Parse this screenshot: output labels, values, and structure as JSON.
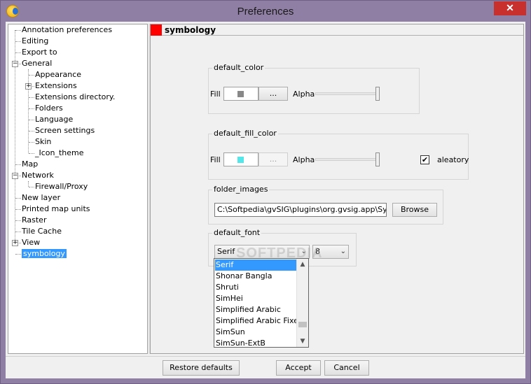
{
  "window": {
    "title": "Preferences",
    "close_label": "✕"
  },
  "tree": {
    "items": [
      {
        "label": "Annotation preferences"
      },
      {
        "label": "Editing"
      },
      {
        "label": "Export to"
      },
      {
        "label": "General"
      },
      {
        "label": "Appearance"
      },
      {
        "label": "Extensions"
      },
      {
        "label": "Extensions directory."
      },
      {
        "label": "Folders"
      },
      {
        "label": "Language"
      },
      {
        "label": "Screen settings"
      },
      {
        "label": "Skin"
      },
      {
        "label": "_Icon_theme"
      },
      {
        "label": "Map"
      },
      {
        "label": "Network"
      },
      {
        "label": "Firewall/Proxy"
      },
      {
        "label": "New layer"
      },
      {
        "label": "Printed map units"
      },
      {
        "label": "Raster"
      },
      {
        "label": "Tile Cache"
      },
      {
        "label": "View"
      },
      {
        "label": "symbology"
      }
    ],
    "expander_minus": "−",
    "expander_plus": "+"
  },
  "panel": {
    "title": "symbology",
    "default_color": {
      "title": "default_color",
      "fill_label": "Fill",
      "swatch_color": "#888888",
      "dots_label": "...",
      "alpha_label": "Alpha",
      "alpha_value_percent": 100
    },
    "default_fill_color": {
      "title": "default_fill_color",
      "fill_label": "Fill",
      "swatch_color": "#55e6ea",
      "dots_label": "...",
      "alpha_label": "Alpha",
      "alpha_value_percent": 100,
      "aleatory_label": "aleatory",
      "aleatory_checked": "✔"
    },
    "folder_images": {
      "title": "folder_images",
      "path": "C:\\Softpedia\\gvSIG\\plugins\\org.gvsig.app\\Symbols",
      "browse_label": "Browse"
    },
    "default_font": {
      "title": "default_font",
      "font_value": "Serif",
      "size_value": "8",
      "arrow": "⌄",
      "options": [
        "Serif",
        "Shonar Bangla",
        "Shruti",
        "SimHei",
        "Simplified Arabic",
        "Simplified Arabic Fixed",
        "SimSun",
        "SimSun-ExtB"
      ],
      "scroll_up": "▲",
      "scroll_down": "▼"
    }
  },
  "watermark": "SOFTPEDIA",
  "buttons": {
    "restore_defaults": "Restore defaults",
    "accept": "Accept",
    "cancel": "Cancel"
  }
}
